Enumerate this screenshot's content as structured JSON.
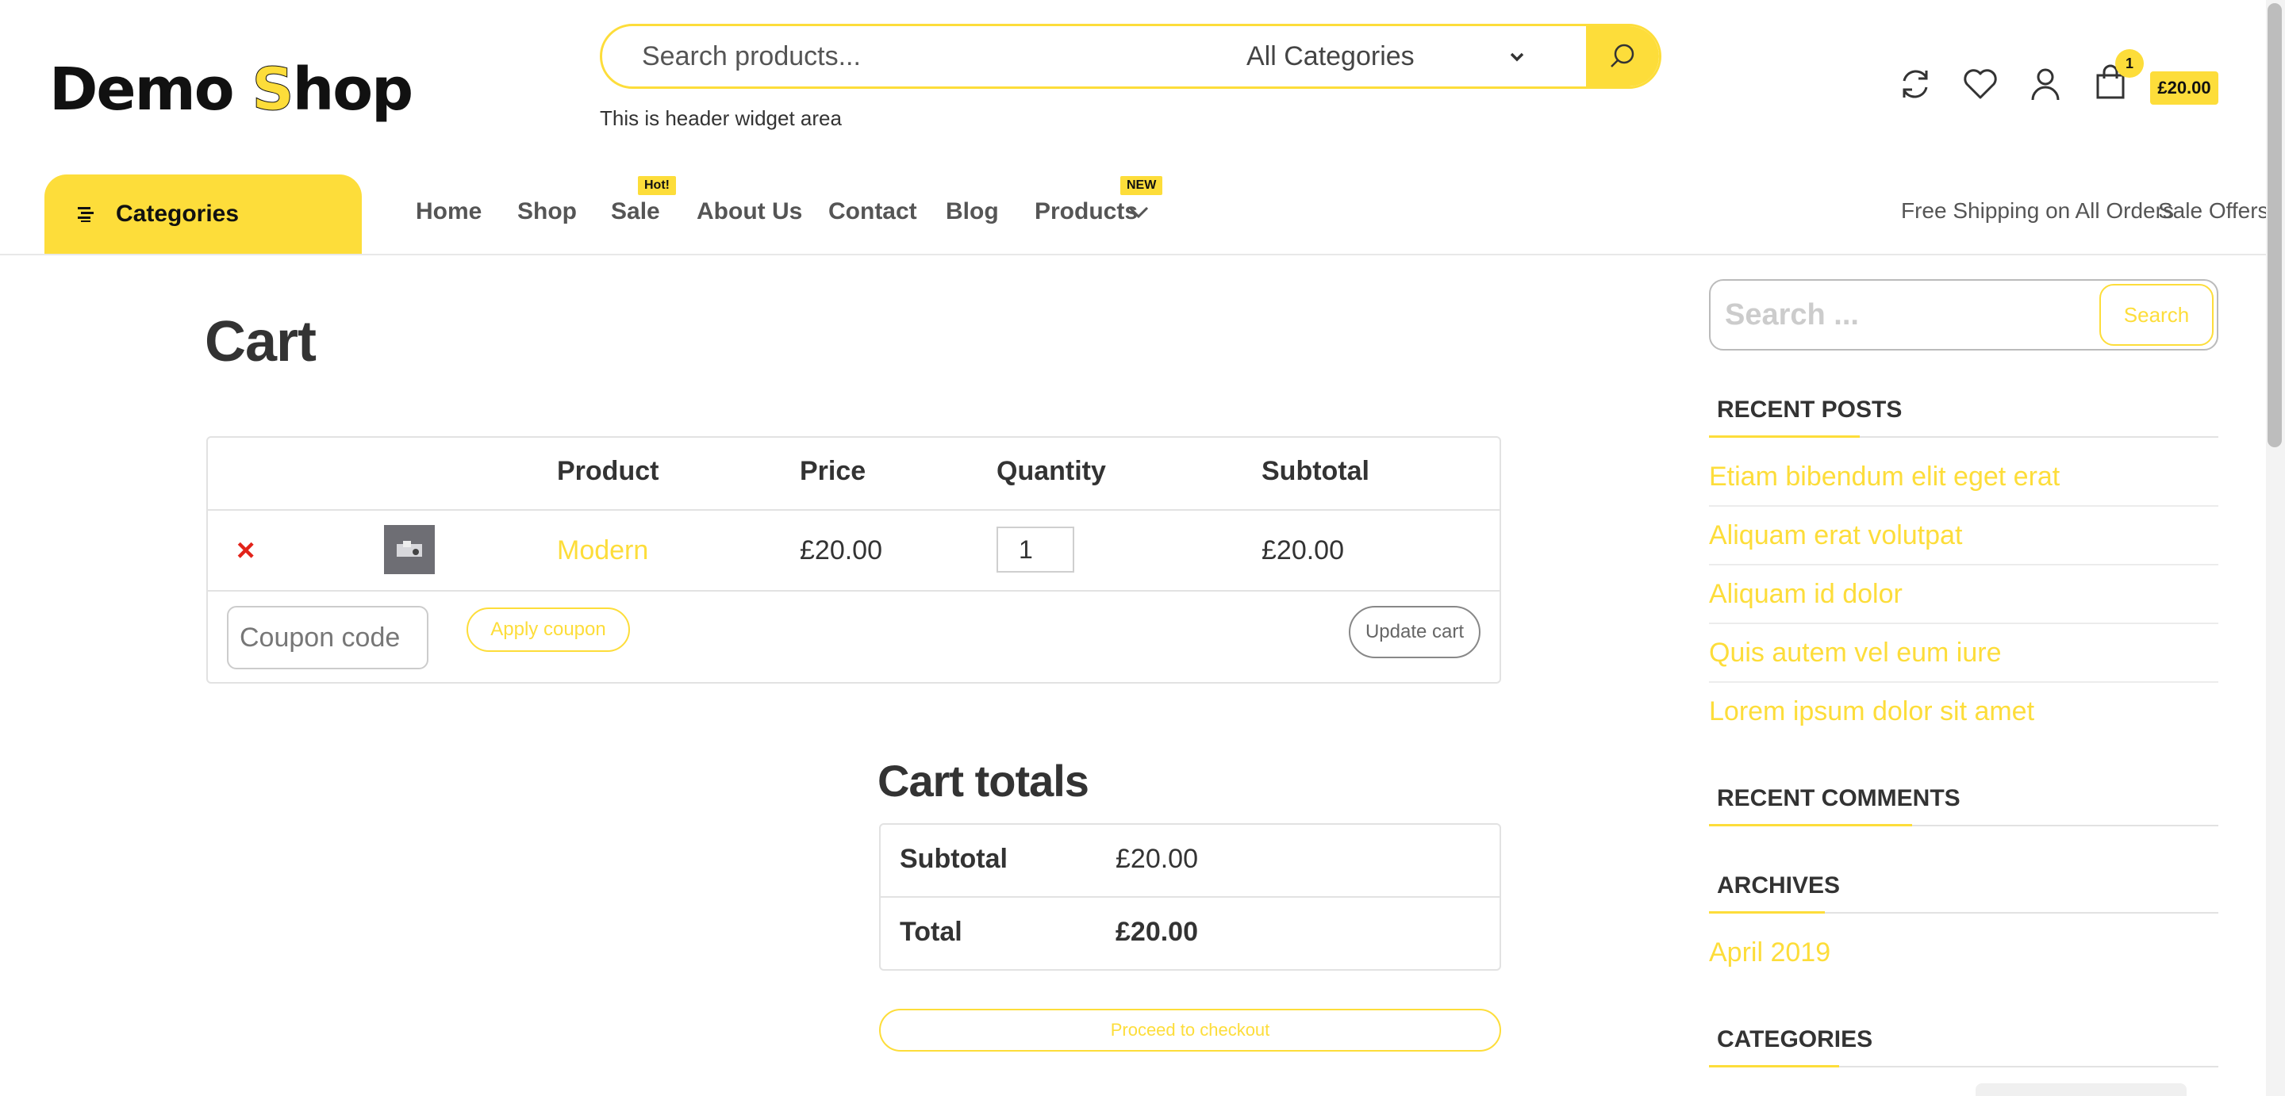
{
  "header": {
    "logo_part1": "Demo ",
    "logo_part2": "S",
    "logo_part3": "hop",
    "search_placeholder": "Search products...",
    "category_select": "All Categories",
    "widget_text": "This is header widget area",
    "cart_count": "1",
    "cart_total": "£20.00",
    "icons": [
      "refresh-icon",
      "heart-icon",
      "user-icon",
      "shopping-bag-icon"
    ]
  },
  "nav": {
    "categories_label": "Categories",
    "items": [
      {
        "label": "Home"
      },
      {
        "label": "Shop"
      },
      {
        "label": "Sale",
        "badge": "Hot!"
      },
      {
        "label": "About Us"
      },
      {
        "label": "Contact"
      },
      {
        "label": "Blog"
      },
      {
        "label": "Products",
        "badge": "NEW"
      }
    ],
    "right_links": [
      "Free Shipping on All Orders",
      "Sale Offers"
    ]
  },
  "main": {
    "title": "Cart",
    "table_headers": [
      "Product",
      "Price",
      "Quantity",
      "Subtotal"
    ],
    "row": {
      "remove": "×",
      "product": "Modern",
      "price": "£20.00",
      "quantity": "1",
      "subtotal": "£20.00"
    },
    "coupon_placeholder": "Coupon code",
    "apply_coupon": "Apply coupon",
    "update_cart": "Update cart",
    "totals_title": "Cart totals",
    "subtotal_label": "Subtotal",
    "subtotal_value": "£20.00",
    "total_label": "Total",
    "total_value": "£20.00",
    "checkout": "Proceed to checkout"
  },
  "sidebar": {
    "search_placeholder": "Search ...",
    "search_button": "Search",
    "recent_posts_title": "RECENT POSTS",
    "recent_posts": [
      "Etiam bibendum elit eget erat",
      "Aliquam erat volutpat",
      "Aliquam id dolor",
      "Quis autem vel eum iure",
      "Lorem ipsum dolor sit amet"
    ],
    "recent_comments_title": "RECENT COMMENTS",
    "archives_title": "ARCHIVES",
    "archives": [
      "April 2019"
    ],
    "categories_title": "CATEGORIES"
  },
  "colors": {
    "accent": "#fddd3a",
    "remove": "#e2231a",
    "text": "#333333"
  }
}
